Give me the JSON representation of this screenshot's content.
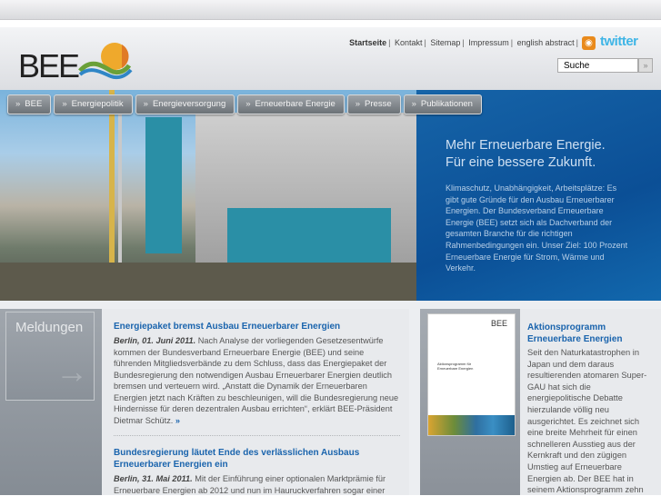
{
  "header": {
    "logo_text": "BEE",
    "links": [
      "Startseite",
      "Kontakt",
      "Sitemap",
      "Impressum",
      "english abstract"
    ],
    "twitter": "twitter",
    "search_placeholder": "Suche",
    "search_go": "»"
  },
  "nav": [
    "BEE",
    "Energiepolitik",
    "Energieversorgung",
    "Erneuerbare Energie",
    "Presse",
    "Publikationen"
  ],
  "hero": {
    "title_line1": "Mehr Erneuerbare Energie.",
    "title_line2": "Für eine bessere Zukunft.",
    "text": "Klimaschutz, Unabhängigkeit, Arbeitsplätze: Es gibt gute Gründe für den Ausbau Erneuerbarer Energien. Der Bundesverband Erneuerbare Energie (BEE) setzt sich als Dachverband der gesamten Branche für die richtigen Rahmenbedingungen ein. Unser Ziel: 100 Prozent Erneuerbare Energie für Strom, Wärme und Verkehr."
  },
  "meldungen": {
    "label": "Meldungen",
    "arrow": "→"
  },
  "news": [
    {
      "title": "Energiepaket bremst Ausbau Erneuerbarer Energien",
      "dateline": "Berlin, 01. Juni 2011.",
      "text": " Nach Analyse der vorliegenden Gesetzesentwürfe kommen der Bundesverband Erneuerbare Energie (BEE) und seine führenden Mitgliedsverbände zu dem Schluss, dass das Energiepaket der Bundesregierung den notwendigen Ausbau Erneuerbarer Energien deutlich bremsen und verteuern wird. „Anstatt die Dynamik der Erneuerbaren Energien jetzt nach Kräften zu beschleunigen, will die Bundesregierung neue Hindernisse für deren dezentralen Ausbau errichten“, erklärt BEE-Präsident Dietmar Schütz. ",
      "more": "»"
    },
    {
      "title": "Bundesregierung läutet Ende des verlässlichen Ausbaus Erneuerbarer Energien ein",
      "dateline": "Berlin, 31. Mai 2011.",
      "text": " Mit der Einführung einer optionalen Marktprämie für Erneuerbare Energien ab 2012 und nun im Hauruckverfahren sogar einer"
    }
  ],
  "aktion": {
    "thumb_logo": "BEE",
    "thumb_title": "Aktionsprogramm für Erneuerbare Energien",
    "title": "Aktionsprogramm Erneuerbare Energien",
    "text": "Seit den Naturkatastrophen in Japan und dem daraus resultierenden atomaren Super-GAU hat sich die energiepolitische Debatte hierzulande völlig neu ausgerichtet. Es zeichnet sich eine breite Mehrheit für einen schnelleren Ausstieg aus der Kernkraft und den zügigen Umstieg auf Erneuerbare Energien ab. Der BEE hat in seinem Aktionsprogramm zehn"
  }
}
